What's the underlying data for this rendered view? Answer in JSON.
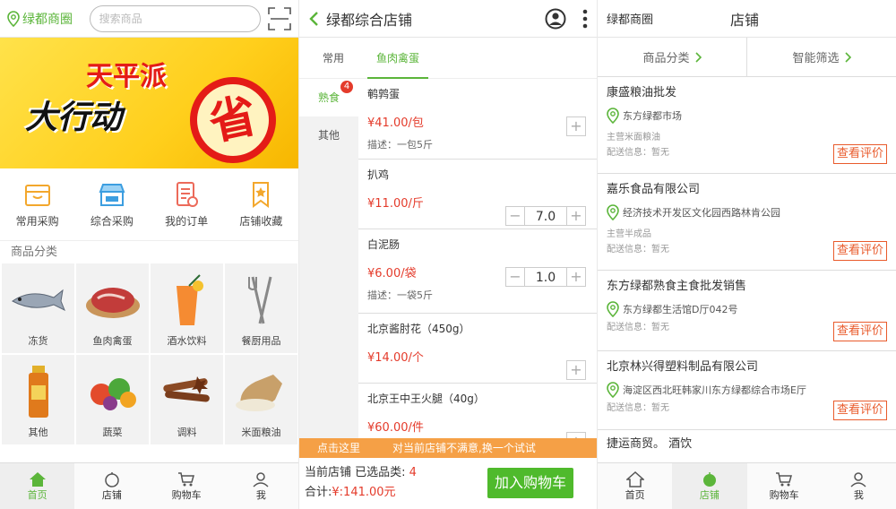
{
  "home": {
    "location": "绿都商圈",
    "search_placeholder": "搜索商品",
    "banner": {
      "line1": "天平派",
      "line2": "大行动",
      "badge": "省"
    },
    "quick": [
      {
        "label": "常用采购",
        "icon": "basket-icon"
      },
      {
        "label": "综合采购",
        "icon": "store-icon"
      },
      {
        "label": "我的订单",
        "icon": "order-icon"
      },
      {
        "label": "店铺收藏",
        "icon": "bookmark-icon"
      }
    ],
    "section_title": "商品分类",
    "categories": [
      "冻货",
      "鱼肉禽蛋",
      "酒水饮料",
      "餐厨用品",
      "其他",
      "蔬菜",
      "调料",
      "米面粮油"
    ]
  },
  "tabs": [
    "首页",
    "店铺",
    "购物车",
    "我"
  ],
  "store": {
    "title": "绿都综合店铺",
    "tabs": [
      "常用",
      "鱼肉禽蛋"
    ],
    "side": [
      {
        "label": "熟食",
        "badge": "4"
      },
      {
        "label": "其他"
      }
    ],
    "products": [
      {
        "name": "鹌鹑蛋",
        "price": "¥41.00/包",
        "desc": "描述：一包5斤"
      },
      {
        "name": "扒鸡",
        "price": "¥11.00/斤",
        "qty": "7.0"
      },
      {
        "name": "白泥肠",
        "price": "¥6.00/袋",
        "qty": "1.0",
        "desc": "描述：一袋5斤"
      },
      {
        "name": "北京酱肘花（450g）",
        "price": "¥14.00/个"
      },
      {
        "name": "北京王中王火腿（40g）",
        "price": "¥60.00/件"
      }
    ],
    "promo_a": "点击这里",
    "promo_b": "对当前店铺不满意,换一个试试",
    "cart_line1_label": "当前店铺 已选品类: ",
    "cart_count": "4",
    "cart_line2_label": "合计:",
    "cart_total": "¥:141.00元",
    "add_cart": "加入购物车"
  },
  "shops": {
    "brand": "绿都商圈",
    "title": "店铺",
    "filters": [
      "商品分类",
      "智能筛选"
    ],
    "review_label": "查看评价",
    "list": [
      {
        "name": "康盛粮油批发",
        "addr": "东方绿都市场",
        "main": "主营米面粮油",
        "delivery": "配送信息：暂无"
      },
      {
        "name": "嘉乐食品有限公司",
        "addr": "经济技术开发区文化园西路林肯公园",
        "main": "主营半成品",
        "delivery": "配送信息：暂无"
      },
      {
        "name": "东方绿都熟食主食批发销售",
        "addr": "东方绿都生活馆D厅042号",
        "delivery": "配送信息：暂无"
      },
      {
        "name": "北京林兴得塑料制品有限公司",
        "addr": "海淀区西北旺韩家川东方绿都综合市场E厅",
        "delivery": "配送信息：暂无"
      },
      {
        "name": "捷运商贸。 酒饮"
      }
    ]
  },
  "colors": {
    "accent": "#5bb53a",
    "price": "#e43b2b",
    "promo": "#f5a046",
    "review": "#e95b2c"
  }
}
